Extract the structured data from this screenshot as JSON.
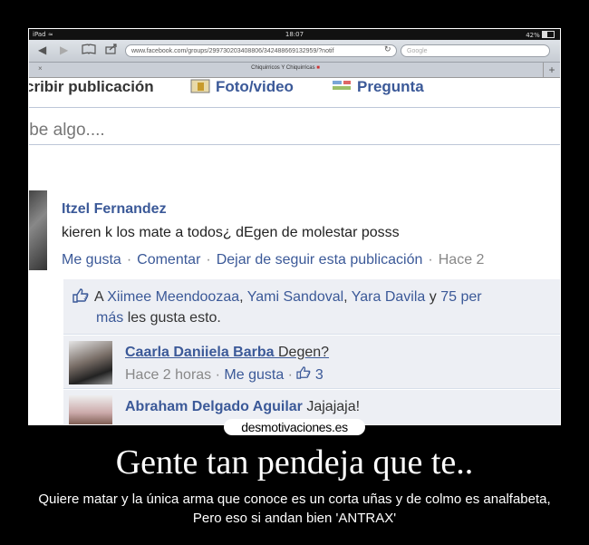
{
  "status_bar": {
    "device": "iPad",
    "wifi": "≈",
    "time": "18:07",
    "battery": "42%"
  },
  "browser": {
    "back": "◀",
    "forward": "▶",
    "bookmarks_icon": "book-icon",
    "share_icon": "share-icon",
    "url": "www.facebook.com/groups/299730203408806/342488669132959/?notif",
    "reload": "↻",
    "search_placeholder": "Google",
    "tab_title": "Chiquirricos Y Chiquirricas",
    "tab_close": "×",
    "new_tab": "+"
  },
  "composer": {
    "tab_write": "cribir publicación",
    "tab_photo": "Foto/video",
    "tab_question": "Pregunta",
    "input_placeholder": "ibe algo...."
  },
  "post": {
    "author": "Itzel Fernandez",
    "message": "kieren k los mate a todos¿ dEgen de molestar posss",
    "like": "Me gusta",
    "comment": "Comentar",
    "unfollow": "Dejar de seguir esta publicación",
    "time": "Hace 2",
    "sep": "·"
  },
  "likes": {
    "prefix": "A",
    "names": [
      "Xiimee Meendoozaa",
      "Yami Sandoval",
      "Yara Davila"
    ],
    "comma": ",",
    "and": "y",
    "more_count": "75 per",
    "more_link": "más",
    "suffix": "les gusta esto."
  },
  "comments": [
    {
      "name": "Caarla Daniiela Barba",
      "text": "Degen?",
      "time": "Hace 2 horas",
      "like": "Me gusta",
      "likes_count": "3"
    },
    {
      "name": "Abraham Delgado Aguilar",
      "text": "Jajajaja!"
    }
  ],
  "watermark": "desmotivaciones.es",
  "headline": "Gente tan pendeja que te..",
  "caption": "Quiere matar y la única arma que conoce es un corta uñas y de colmo es analfabeta, Pero eso si  andan bien 'ANTRAX'"
}
